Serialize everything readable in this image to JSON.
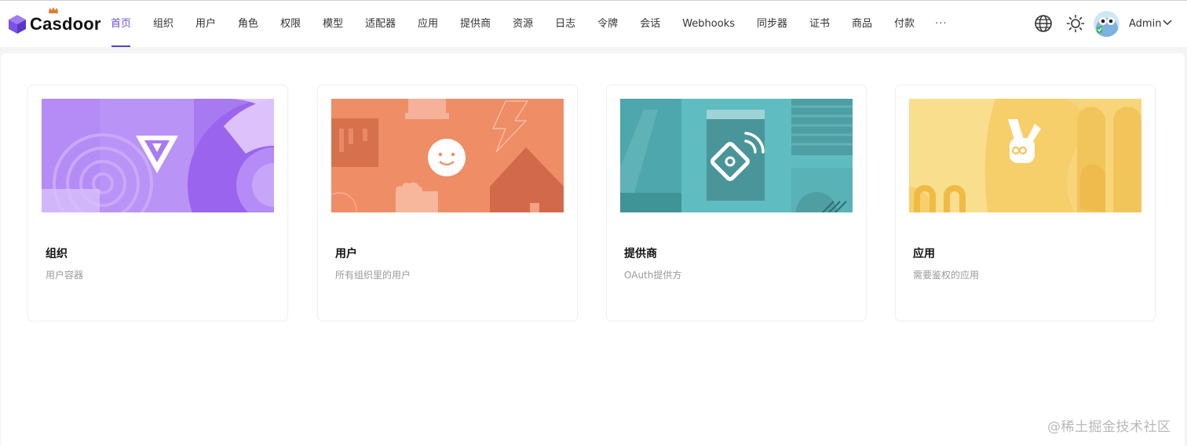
{
  "brand": {
    "name": "Casdoor"
  },
  "nav": {
    "items": [
      {
        "label": "首页",
        "active": true
      },
      {
        "label": "组织"
      },
      {
        "label": "用户"
      },
      {
        "label": "角色"
      },
      {
        "label": "权限"
      },
      {
        "label": "模型"
      },
      {
        "label": "适配器"
      },
      {
        "label": "应用"
      },
      {
        "label": "提供商"
      },
      {
        "label": "资源"
      },
      {
        "label": "日志"
      },
      {
        "label": "令牌"
      },
      {
        "label": "会话"
      },
      {
        "label": "Webhooks"
      },
      {
        "label": "同步器"
      },
      {
        "label": "证书"
      },
      {
        "label": "商品"
      },
      {
        "label": "付款"
      }
    ],
    "more_label": "···"
  },
  "header": {
    "icons": [
      "globe-icon",
      "sun-icon"
    ],
    "user": {
      "name": "Admin"
    }
  },
  "cards": [
    {
      "title": "组织",
      "description": "用户容器",
      "theme": "#9b6cf0"
    },
    {
      "title": "用户",
      "description": "所有组织里的用户",
      "theme": "#ef8c65"
    },
    {
      "title": "提供商",
      "description": "OAuth提供方",
      "theme": "#5fbcc1"
    },
    {
      "title": "应用",
      "description": "需要鉴权的应用",
      "theme": "#f6cf6a"
    }
  ],
  "watermark": "@稀土掘金技术社区",
  "colors": {
    "accent": "#5b3fd1",
    "page_bg": "#f4f4f4"
  }
}
